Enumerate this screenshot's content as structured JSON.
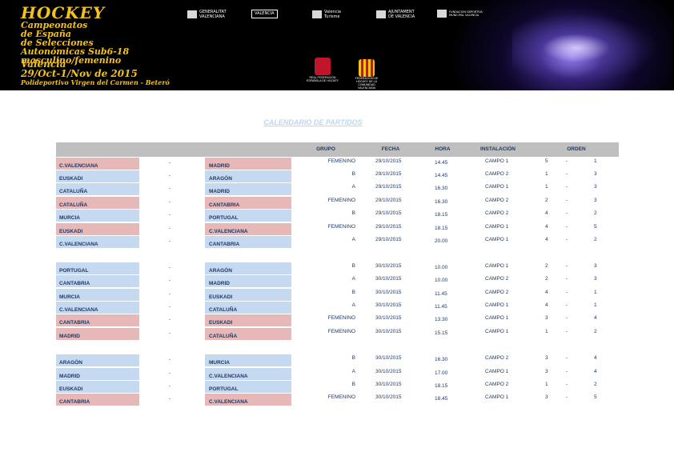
{
  "banner": {
    "title_lines": [
      "HOCKEY",
      "Campeonatos",
      "de España",
      "de Selecciones",
      "Autonómicas Sub6-18",
      "masculino/femenino"
    ],
    "city": "Valencia",
    "dates": "29/Oct-1/Nov de 2015",
    "venue": "Polideportivo Virgen del Carmen - Beteró",
    "logos": [
      {
        "name": "GENERALITAT VALENCIANA"
      },
      {
        "name": "VALENCIA"
      },
      {
        "name": "Valencia Turisme"
      },
      {
        "name": "AJUNTAMENT DE VALENCIA"
      },
      {
        "name": "FUNDACION DEPORTIVA MUNICIPAL VALENCIA"
      },
      {
        "name": "REAL FEDERACION ESPAÑOLA DE HOCKEY"
      },
      {
        "name": "FEDERACION DE HOCKEY DE LA COMUNIDAD VALENCIANA"
      }
    ]
  },
  "page_title": "CALENDARIO DE PARTIDOS",
  "headers": {
    "grupo": "GRUPO",
    "fecha": "FECHA",
    "hora": "HORA",
    "instalacion": "INSTALACIÓN",
    "orden": "ORDEN"
  },
  "colors": {
    "blue": "#c5d9f1",
    "pink": "#e6b8b7",
    "header": "#bfbfbf",
    "text": "#1f3864"
  },
  "matches": [
    {
      "home": "C.VALENCIANA",
      "away": "MADRID",
      "home_color": "pink",
      "away_color": "pink",
      "grupo": "FEMENINO",
      "fecha": "29/10/2015",
      "hora": "14.45",
      "campo": "CAMPO 1",
      "o1": "5",
      "o2": "1"
    },
    {
      "home": "EUSKADI",
      "away": "ARAGÓN",
      "home_color": "blue",
      "away_color": "blue",
      "grupo": "B",
      "fecha": "29/10/2015",
      "hora": "14.45",
      "campo": "CAMPO 2",
      "o1": "1",
      "o2": "3"
    },
    {
      "home": "CATALUÑA",
      "away": "MADRID",
      "home_color": "blue",
      "away_color": "blue",
      "grupo": "A",
      "fecha": "29/10/2015",
      "hora": "16.30",
      "campo": "CAMPO 1",
      "o1": "1",
      "o2": "3"
    },
    {
      "home": "CATALUÑA",
      "away": "CANTABRIA",
      "home_color": "pink",
      "away_color": "pink",
      "grupo": "FEMENINO",
      "fecha": "29/10/2015",
      "hora": "16.30",
      "campo": "CAMPO 2",
      "o1": "2",
      "o2": "3"
    },
    {
      "home": "MURCIA",
      "away": "PORTUGAL",
      "home_color": "blue",
      "away_color": "blue",
      "grupo": "B",
      "fecha": "29/10/2015",
      "hora": "18.15",
      "campo": "CAMPO 2",
      "o1": "4",
      "o2": "2"
    },
    {
      "home": "EUSKADI",
      "away": "C.VALENCIANA",
      "home_color": "pink",
      "away_color": "pink",
      "grupo": "FEMENINO",
      "fecha": "29/10/2015",
      "hora": "18.15",
      "campo": "CAMPO 1",
      "o1": "4",
      "o2": "5"
    },
    {
      "home": "C.VALENCIANA",
      "away": "CANTABRIA",
      "home_color": "blue",
      "away_color": "blue",
      "grupo": "A",
      "fecha": "29/10/2015",
      "hora": "20.00",
      "campo": "CAMPO 1",
      "o1": "4",
      "o2": "2"
    },
    {
      "home": "PORTUGAL",
      "away": "ARAGÓN",
      "home_color": "blue",
      "away_color": "blue",
      "grupo": "B",
      "fecha": "30/10/2015",
      "hora": "10.00",
      "campo": "CAMPO 1",
      "o1": "2",
      "o2": "3"
    },
    {
      "home": "CANTABRIA",
      "away": "MADRID",
      "home_color": "blue",
      "away_color": "blue",
      "grupo": "A",
      "fecha": "30/10/2015",
      "hora": "10.00",
      "campo": "CAMPO 2",
      "o1": "2",
      "o2": "3"
    },
    {
      "home": "MURCIA",
      "away": "EUSKADI",
      "home_color": "blue",
      "away_color": "blue",
      "grupo": "B",
      "fecha": "30/10/2015",
      "hora": "11.45",
      "campo": "CAMPO 2",
      "o1": "4",
      "o2": "1"
    },
    {
      "home": "C.VALENCIANA",
      "away": "CATALUÑA",
      "home_color": "blue",
      "away_color": "blue",
      "grupo": "A",
      "fecha": "30/10/2015",
      "hora": "11.45",
      "campo": "CAMPO 1",
      "o1": "4",
      "o2": "1"
    },
    {
      "home": "CANTABRIA",
      "away": "EUSKADI",
      "home_color": "pink",
      "away_color": "pink",
      "grupo": "FEMENINO",
      "fecha": "30/10/2015",
      "hora": "13.30",
      "campo": "CAMPO 1",
      "o1": "3",
      "o2": "4"
    },
    {
      "home": "MADRID",
      "away": "CATALUÑA",
      "home_color": "pink",
      "away_color": "pink",
      "grupo": "FEMENINO",
      "fecha": "30/10/2015",
      "hora": "15.15",
      "campo": "CAMPO 1",
      "o1": "1",
      "o2": "2"
    },
    {
      "home": "ARAGÓN",
      "away": "MURCIA",
      "home_color": "blue",
      "away_color": "blue",
      "grupo": "B",
      "fecha": "30/10/2015",
      "hora": "16.30",
      "campo": "CAMPO 2",
      "o1": "3",
      "o2": "4"
    },
    {
      "home": "MADRID",
      "away": "C.VALENCIANA",
      "home_color": "blue",
      "away_color": "blue",
      "grupo": "A",
      "fecha": "30/10/2015",
      "hora": "17.00",
      "campo": "CAMPO 1",
      "o1": "3",
      "o2": "4"
    },
    {
      "home": "EUSKADI",
      "away": "PORTUGAL",
      "home_color": "blue",
      "away_color": "blue",
      "grupo": "B",
      "fecha": "30/10/2015",
      "hora": "18.15",
      "campo": "CAMPO 2",
      "o1": "1",
      "o2": "2"
    },
    {
      "home": "CANTABRIA",
      "away": "C.VALENCIANA",
      "home_color": "pink",
      "away_color": "pink",
      "grupo": "FEMENINO",
      "fecha": "30/10/2015",
      "hora": "18.45",
      "campo": "CAMPO 1",
      "o1": "3",
      "o2": "5"
    }
  ]
}
